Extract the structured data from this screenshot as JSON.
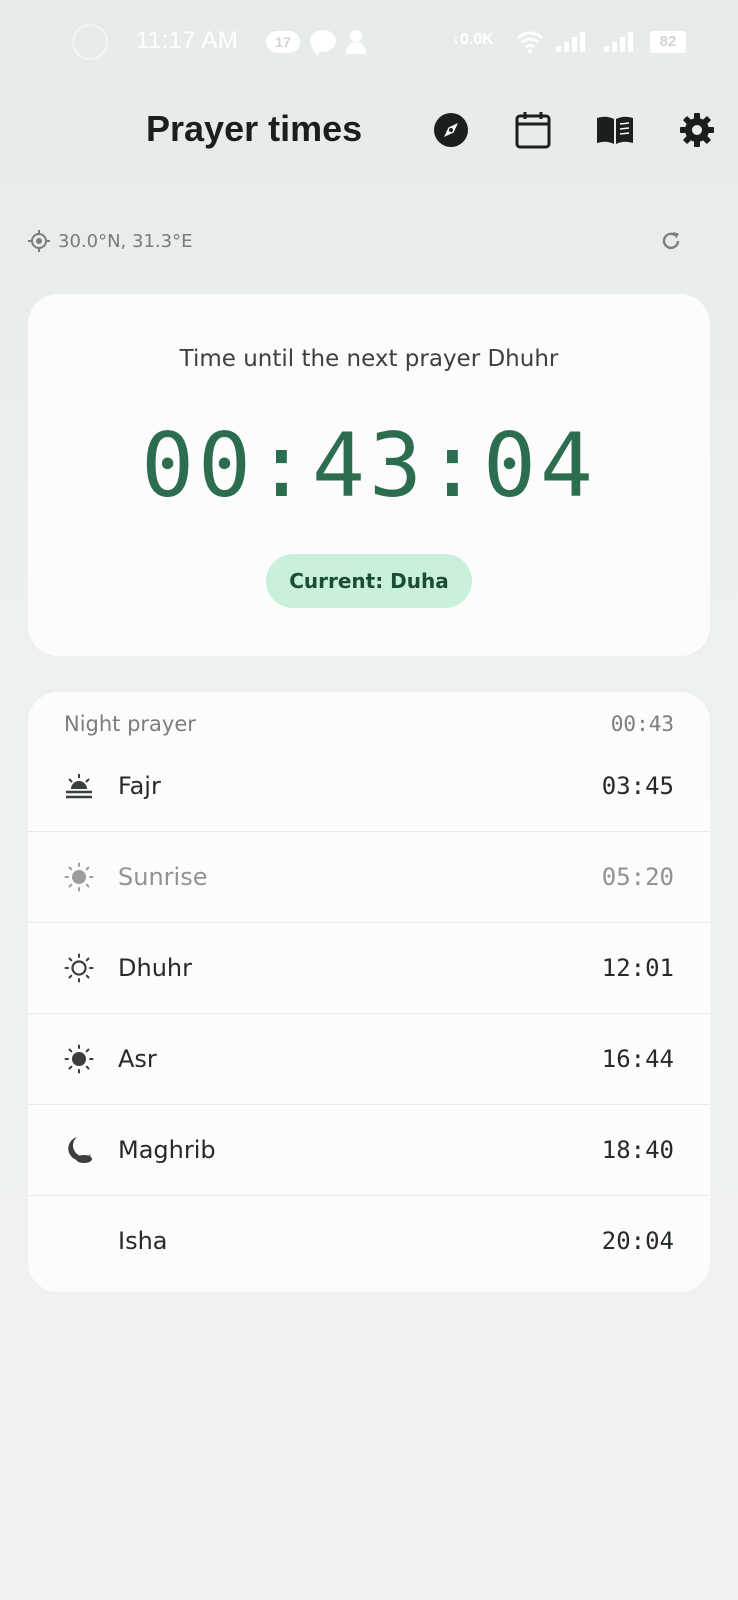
{
  "status_bar": {
    "time": "11:17 AM",
    "notification_count": "17",
    "net_speed": "0.0K",
    "battery": "82"
  },
  "header": {
    "title": "Prayer times",
    "icons": [
      "compass-icon",
      "calendar-icon",
      "book-icon",
      "gear-icon"
    ]
  },
  "location": {
    "coords": "30.0°N, 31.3°E"
  },
  "countdown_card": {
    "next_label": "Time until the next prayer Dhuhr",
    "countdown": "00:43:04",
    "current_label": "Current: Duha"
  },
  "prayers": {
    "night": {
      "label": "Night prayer",
      "time": "00:43"
    },
    "items": [
      {
        "name": "Fajr",
        "time": "03:45",
        "icon": "sunrise-horizon-icon"
      },
      {
        "name": "Sunrise",
        "time": "05:20",
        "icon": "sun-icon"
      },
      {
        "name": "Dhuhr",
        "time": "12:01",
        "icon": "sun-outline-icon"
      },
      {
        "name": "Asr",
        "time": "16:44",
        "icon": "sun-filled-icon"
      },
      {
        "name": "Maghrib",
        "time": "18:40",
        "icon": "moon-cloud-icon"
      },
      {
        "name": "Isha",
        "time": "20:04",
        "icon": "crescent-moon-icon"
      }
    ]
  },
  "colors": {
    "accent": "#2d6d4f",
    "pill_bg": "#c8f0da",
    "card_bg": "#fbfcfb"
  }
}
